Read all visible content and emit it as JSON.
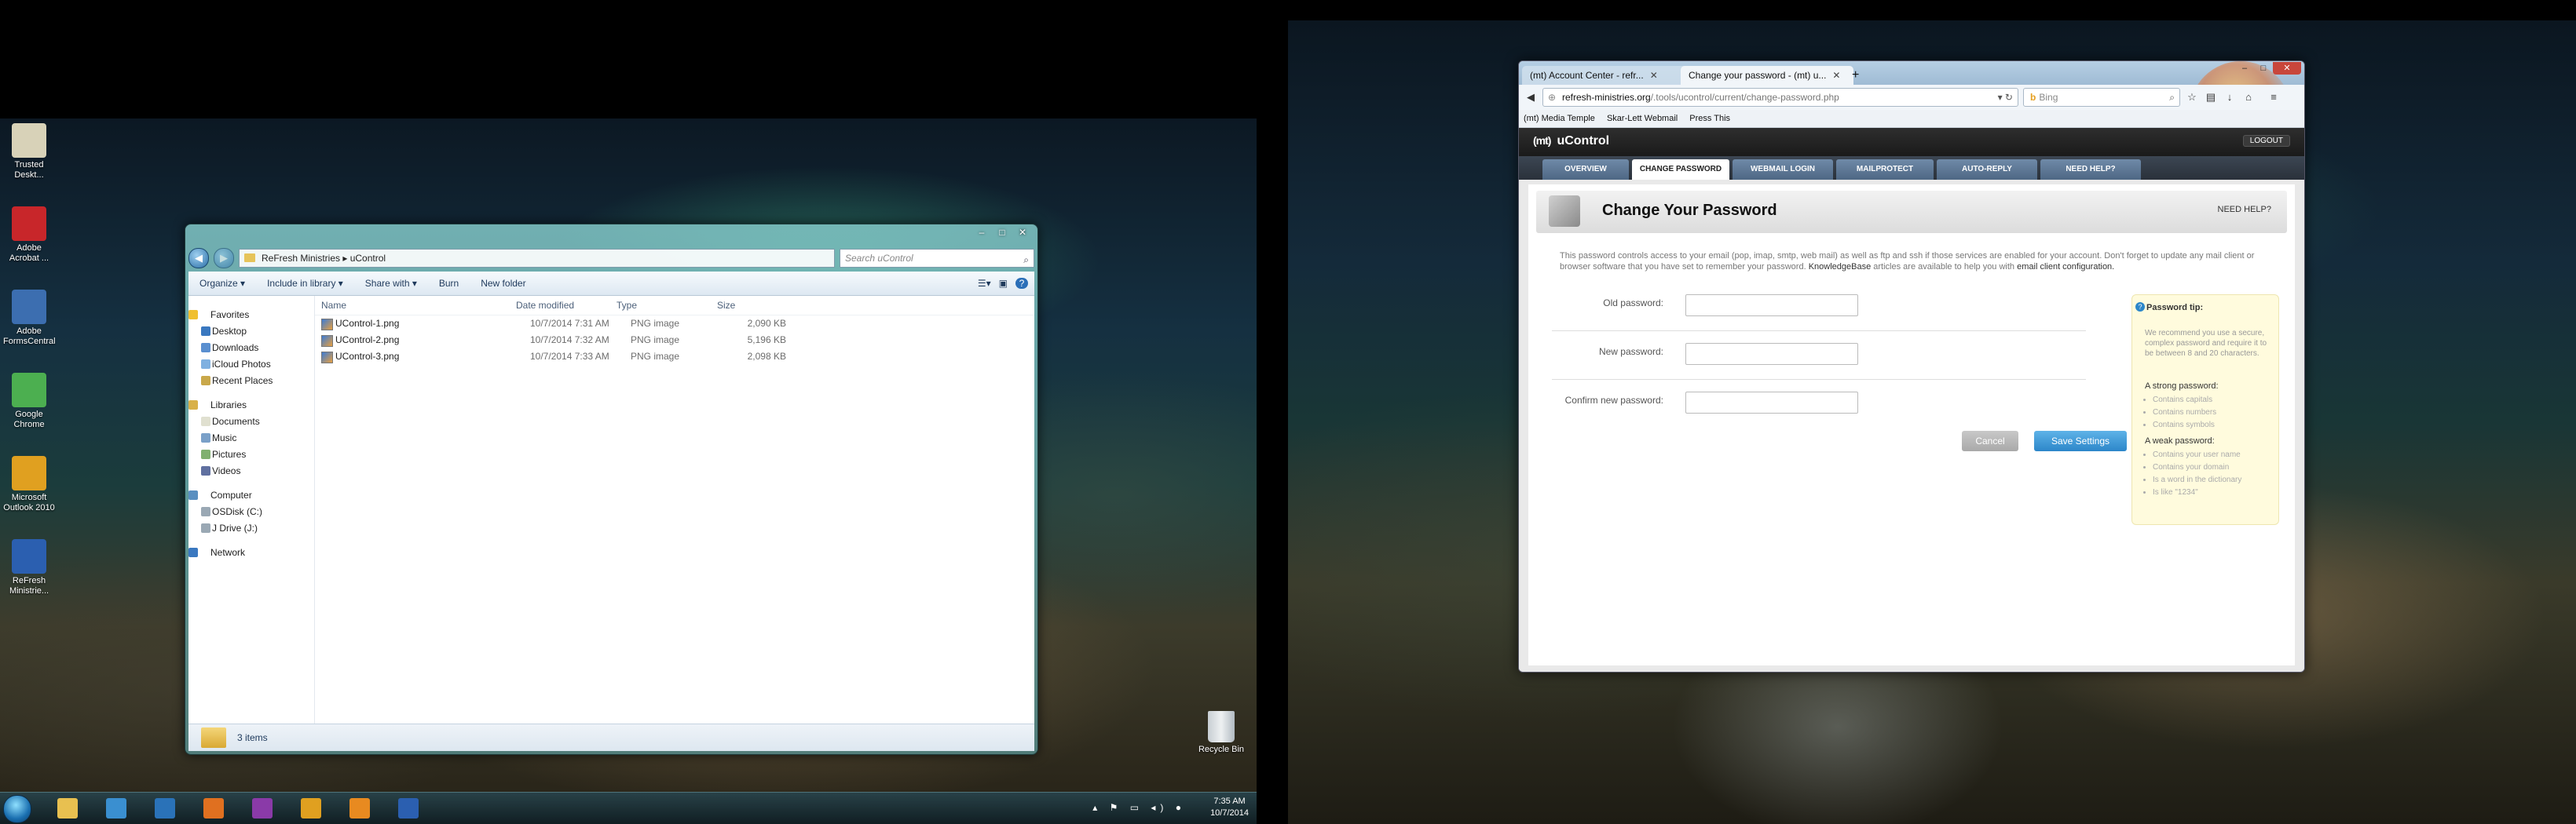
{
  "desktop": {
    "icons": [
      {
        "label": "Trusted Deskt...",
        "color": "#d8d2b8"
      },
      {
        "label": "Adobe Acrobat ...",
        "color": "#c8262a"
      },
      {
        "label": "Adobe FormsCentral",
        "color": "#3c6eb0"
      },
      {
        "label": "Google Chrome",
        "color": "#4caf50"
      },
      {
        "label": "Microsoft Outlook 2010",
        "color": "#e0a020"
      },
      {
        "label": "ReFresh Ministrie...",
        "color": "#2b5fb0"
      }
    ],
    "recycle_bin": "Recycle Bin"
  },
  "explorer": {
    "address": "ReFresh Ministries  ▸  uControl",
    "search_placeholder": "Search uControl",
    "toolbar": [
      "Organize ▾",
      "Include in library ▾",
      "Share with ▾",
      "Burn",
      "New folder"
    ],
    "nav": {
      "favorites": "Favorites",
      "fav_items": [
        "Desktop",
        "Downloads",
        "iCloud Photos",
        "Recent Places"
      ],
      "libraries": "Libraries",
      "lib_items": [
        "Documents",
        "Music",
        "Pictures",
        "Videos"
      ],
      "computer": "Computer",
      "comp_items": [
        "OSDisk (C:)",
        "J Drive (J:)"
      ],
      "network": "Network"
    },
    "columns": [
      "Name",
      "Date modified",
      "Type",
      "Size"
    ],
    "files": [
      {
        "name": "UControl-1.png",
        "date": "10/7/2014 7:31 AM",
        "type": "PNG image",
        "size": "2,090 KB"
      },
      {
        "name": "UControl-2.png",
        "date": "10/7/2014 7:32 AM",
        "type": "PNG image",
        "size": "5,196 KB"
      },
      {
        "name": "UControl-3.png",
        "date": "10/7/2014 7:33 AM",
        "type": "PNG image",
        "size": "2,098 KB"
      }
    ],
    "status": "3 items"
  },
  "taskbar": {
    "time": "7:35 AM",
    "date": "10/7/2014",
    "apps": [
      {
        "icon": "explorer-icon",
        "color": "#e8c050"
      },
      {
        "icon": "quick-access-icon",
        "color": "#3a8fd0"
      },
      {
        "icon": "publisher-icon",
        "color": "#2a72b8"
      },
      {
        "icon": "firefox-icon",
        "color": "#e07020"
      },
      {
        "icon": "onenote-icon",
        "color": "#8a3aa8"
      },
      {
        "icon": "outlook-icon",
        "color": "#e0a020"
      },
      {
        "icon": "settings-icon",
        "color": "#e88a20"
      },
      {
        "icon": "word-icon",
        "color": "#2b5fb0"
      }
    ]
  },
  "browser": {
    "tabs": [
      {
        "label": "(mt) Account Center - refr..."
      },
      {
        "label": "Change your password - (mt) u..."
      }
    ],
    "new_tab": "+",
    "url_host": "refresh-ministries.org",
    "url_path": "/.tools/ucontrol/current/change-password.php",
    "search_engine": "Bing",
    "bookmarks": [
      "(mt) Media Temple",
      "Skar-Lett Webmail",
      "Press This"
    ]
  },
  "ucontrol": {
    "brand_mark": "(mt)",
    "brand": "uControl",
    "logout": "LOGOUT",
    "tabs": [
      "OVERVIEW",
      "CHANGE PASSWORD",
      "WEBMAIL LOGIN",
      "MAILPROTECT",
      "AUTO-REPLY",
      "NEED HELP?"
    ],
    "title": "Change Your Password",
    "need_help": "NEED HELP?",
    "intro_1": "This password controls access to your email (pop, imap, smtp, web mail) as well as ftp and ssh if those services are enabled for your account. Don't forget to update",
    "intro_2": "any mail client or browser software that you have set to remember your password.",
    "intro_kb": "KnowledgeBase",
    "intro_3": "articles are available to help you with",
    "intro_link": "email client configuration.",
    "fields": [
      {
        "label": "Old password:"
      },
      {
        "label": "New password:"
      },
      {
        "label": "Confirm new password:"
      }
    ],
    "cancel": "Cancel",
    "save": "Save Settings",
    "tip": {
      "title": "Password tip:",
      "text": "We recommend you use a secure, complex password and require it to be between 8 and 20 characters.",
      "strong_h": "A strong password:",
      "strong": [
        "Contains capitals",
        "Contains numbers",
        "Contains symbols"
      ],
      "weak_h": "A weak password:",
      "weak": [
        "Contains your user name",
        "Contains your domain",
        "Is a word in the dictionary",
        "Is like \"1234\""
      ]
    }
  }
}
